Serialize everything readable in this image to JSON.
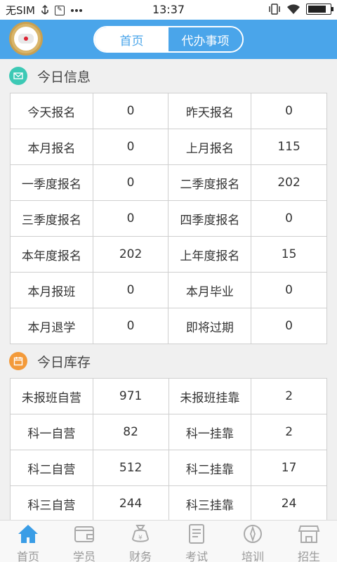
{
  "status_bar": {
    "carrier": "无SIM",
    "time": "13:37",
    "battery_level": 0.9
  },
  "header": {
    "tabs": [
      {
        "label": "首页",
        "active": true
      },
      {
        "label": "代办事项",
        "active": false
      }
    ]
  },
  "info_section": {
    "title": "今日信息",
    "icon": "mail-icon",
    "icon_color": "#3dc9b5",
    "rows": [
      {
        "label1": "今天报名",
        "value1": "0",
        "label2": "昨天报名",
        "value2": "0"
      },
      {
        "label1": "本月报名",
        "value1": "0",
        "label2": "上月报名",
        "value2": "115"
      },
      {
        "label1": "一季度报名",
        "value1": "0",
        "label2": "二季度报名",
        "value2": "202"
      },
      {
        "label1": "三季度报名",
        "value1": "0",
        "label2": "四季度报名",
        "value2": "0"
      },
      {
        "label1": "本年度报名",
        "value1": "202",
        "label2": "上年度报名",
        "value2": "15"
      },
      {
        "label1": "本月报班",
        "value1": "0",
        "label2": "本月毕业",
        "value2": "0"
      },
      {
        "label1": "本月退学",
        "value1": "0",
        "label2": "即将过期",
        "value2": "0"
      }
    ]
  },
  "stock_section": {
    "title": "今日库存",
    "icon": "calendar-icon",
    "icon_color": "#f39a3a",
    "rows": [
      {
        "label1": "未报班自营",
        "value1": "971",
        "label2": "未报班挂靠",
        "value2": "2"
      },
      {
        "label1": "科一自营",
        "value1": "82",
        "label2": "科一挂靠",
        "value2": "2"
      },
      {
        "label1": "科二自营",
        "value1": "512",
        "label2": "科二挂靠",
        "value2": "17"
      },
      {
        "label1": "科三自营",
        "value1": "244",
        "label2": "科三挂靠",
        "value2": "24"
      }
    ]
  },
  "bottom_nav": {
    "items": [
      {
        "label": "首页",
        "icon": "home-icon",
        "active": true
      },
      {
        "label": "学员",
        "icon": "wallet-icon",
        "active": false
      },
      {
        "label": "财务",
        "icon": "money-bag-icon",
        "active": false
      },
      {
        "label": "考试",
        "icon": "exam-paper-icon",
        "active": false
      },
      {
        "label": "培训",
        "icon": "compass-icon",
        "active": false
      },
      {
        "label": "招生",
        "icon": "store-icon",
        "active": false
      }
    ],
    "active_color": "#3a9de6",
    "inactive_color": "#999999"
  }
}
